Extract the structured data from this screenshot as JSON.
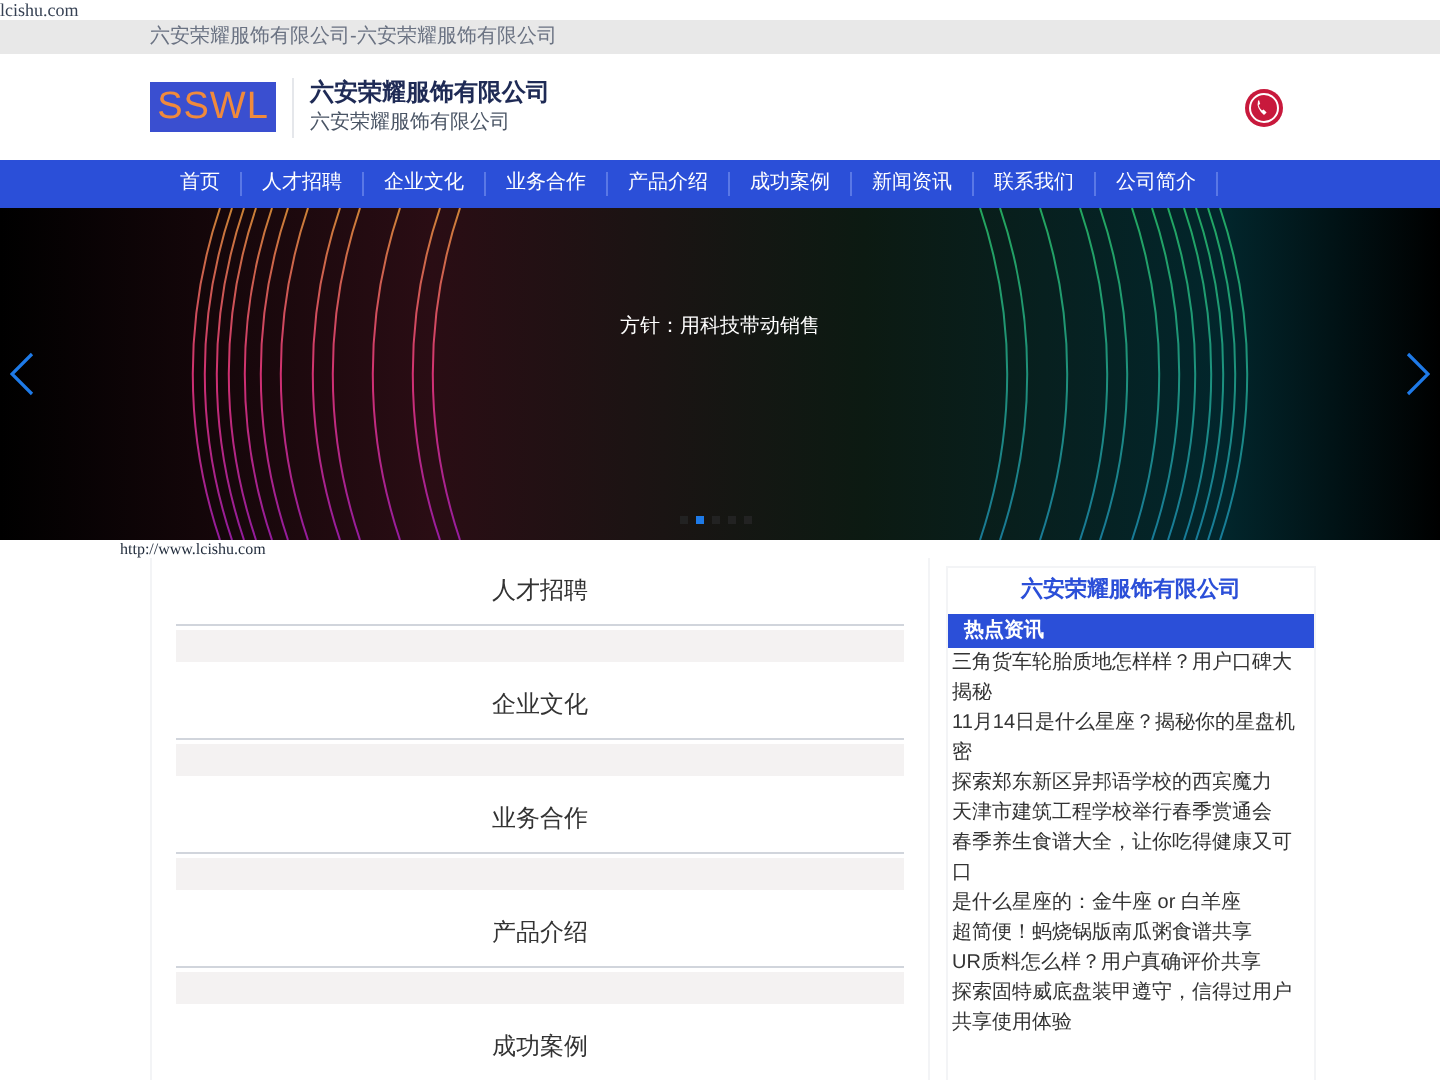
{
  "top_link": "lcishu.com",
  "breadcrumb": "六安荣耀服饰有限公司-六安荣耀服饰有限公司",
  "header": {
    "logo": "SSWL",
    "company": "六安荣耀服饰有限公司",
    "subtitle": "六安荣耀服饰有限公司"
  },
  "nav": [
    "首页",
    "人才招聘",
    "企业文化",
    "业务合作",
    "产品介绍",
    "成功案例",
    "新闻资讯",
    "联系我们",
    "公司简介"
  ],
  "banner": {
    "caption": "方针：用科技带动销售",
    "dots": [
      {
        "selected": false
      },
      {
        "selected": true
      },
      {
        "selected": false
      },
      {
        "selected": false
      },
      {
        "selected": false
      }
    ]
  },
  "url_text": "http://www.lcishu.com",
  "sections": [
    "人才招聘",
    "企业文化",
    "业务合作",
    "产品介绍",
    "成功案例"
  ],
  "sidebar": {
    "title": "六安荣耀服饰有限公司",
    "heading": "热点资讯",
    "items": [
      "三角货车轮胎质地怎样样？用户口碑大揭秘",
      "11月14日是什么星座？揭秘你的星盘机密",
      "探索郑东新区异邦语学校的西宾魔力",
      "天津市建筑工程学校举行春季赏通会",
      "春季养生食谱大全，让你吃得健康又可口",
      "是什么星座的：金牛座 or 白羊座",
      "超简便！蚂烧锅版南瓜粥食谱共享",
      "UR质料怎么样？用户真确评价共享",
      "探索固特威底盘装甲遵守，信得过用户共享使用体验"
    ]
  }
}
